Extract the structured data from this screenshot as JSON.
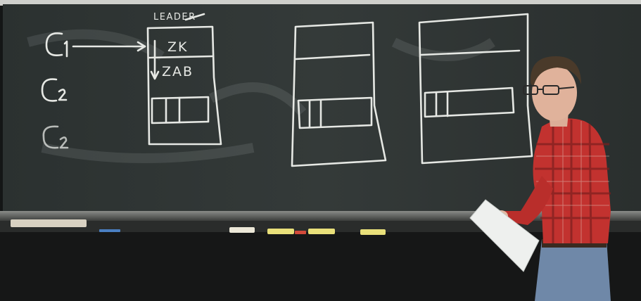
{
  "board": {
    "leader_label": "LEADER",
    "client_labels": [
      "C1",
      "C2",
      "C2"
    ],
    "server1": {
      "top_layer": "ZK",
      "bottom_layer": "ZAB"
    }
  },
  "colors": {
    "board": "#2e3332",
    "chalk": "#e6e8e4",
    "wall": "#161818",
    "shirt": "#c2322f",
    "jeans": "#6f88a8"
  }
}
